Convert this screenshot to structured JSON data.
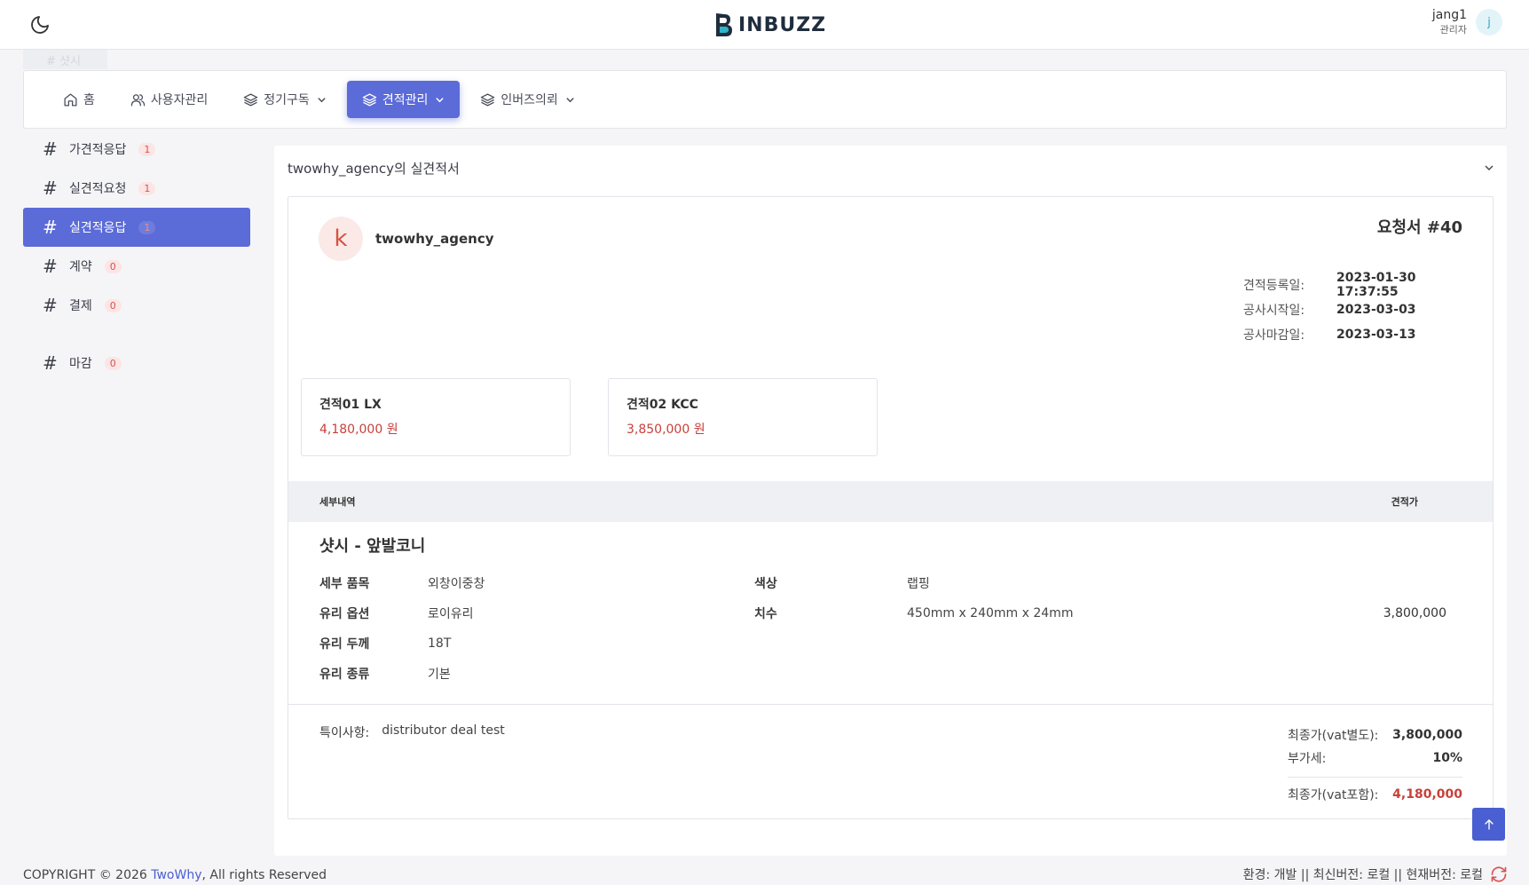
{
  "brand": {
    "name": "INBUZZ"
  },
  "user": {
    "name": "jang1",
    "role": "관리자",
    "initial": "j"
  },
  "ghost_tab": "# 샷시",
  "nav": {
    "home": "홈",
    "users": "사용자관리",
    "subscription": "정기구독",
    "quotes": "견적관리",
    "inbuzz_request": "인버즈의뢰"
  },
  "sidebar": {
    "items": [
      {
        "label": "가견적응답",
        "count": "1"
      },
      {
        "label": "실견적요청",
        "count": "1"
      },
      {
        "label": "실견적응답",
        "count": "1"
      },
      {
        "label": "계약",
        "count": "0"
      },
      {
        "label": "결제",
        "count": "0"
      },
      {
        "label": "마감",
        "count": "0"
      }
    ]
  },
  "panel": {
    "title": "twowhy_agency의 실견적서",
    "agency_initial": "k",
    "agency_name": "twowhy_agency",
    "request_no": "요청서 #40",
    "dates": [
      {
        "label": "견적등록일:",
        "value": "2023-01-30 17:37:55"
      },
      {
        "label": "공사시작일:",
        "value": "2023-03-03"
      },
      {
        "label": "공사마감일:",
        "value": "2023-03-13"
      }
    ],
    "quotes": [
      {
        "name": "견적01 LX",
        "price": "4,180,000 원"
      },
      {
        "name": "견적02 KCC",
        "price": "3,850,000 원"
      }
    ],
    "detail_header": {
      "left": "세부내역",
      "right": "견적가"
    },
    "product_title": "샷시 - 앞발코니",
    "specs": {
      "item_label": "세부 품목",
      "item_value": "외창이중창",
      "glass_option_label": "유리 옵션",
      "glass_option_value": "로이유리",
      "glass_thickness_label": "유리 두께",
      "glass_thickness_value": "18T",
      "glass_type_label": "유리 종류",
      "glass_type_value": "기본",
      "color_label": "색상",
      "color_value": "랩핑",
      "size_label": "치수",
      "size_value": "450mm x 240mm x 24mm"
    },
    "line_price": "3,800,000",
    "note_label": "특이사항:",
    "note_value": "distributor deal test",
    "totals": {
      "excl_label": "최종가(vat별도):",
      "excl_value": "3,800,000",
      "vat_label": "부가세:",
      "vat_value": "10%",
      "incl_label": "최종가(vat포함):",
      "incl_value": "4,180,000"
    }
  },
  "footer": {
    "copyright_prefix": "COPYRIGHT © 2026 ",
    "company": "TwoWhy",
    "copyright_suffix": ", All rights Reserved",
    "env": "환경: 개발 || 최신버전: 로컬 || 현재버전: 로컬"
  },
  "colors": {
    "accent": "#5b6bd8",
    "price_red": "#c9403a",
    "badge_bg": "#fbe5e5"
  },
  "icons": [
    "moon-icon",
    "home-icon",
    "users-icon",
    "layers-icon",
    "chevron-down-icon",
    "hash-icon",
    "arrow-up-icon",
    "refresh-icon"
  ]
}
